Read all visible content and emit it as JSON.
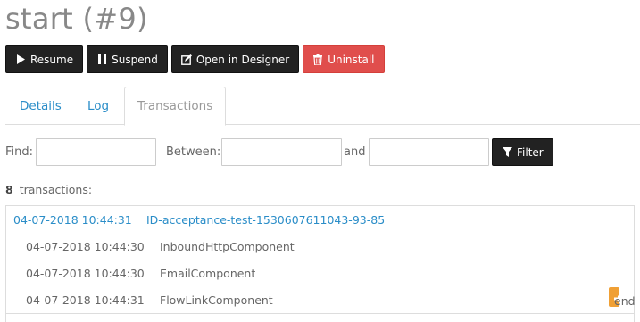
{
  "page": {
    "title": "start (#9)"
  },
  "toolbar": {
    "resume_label": "Resume",
    "suspend_label": "Suspend",
    "designer_label": "Open in Designer",
    "uninstall_label": "Uninstall",
    "colors": {
      "dark": "#222222",
      "danger": "#e04e4c"
    }
  },
  "tabs": [
    {
      "label": "Details",
      "active": false
    },
    {
      "label": "Log",
      "active": false
    },
    {
      "label": "Transactions",
      "active": true
    }
  ],
  "filter": {
    "find_label": "Find:",
    "find_value": "",
    "between_label": "Between:",
    "between_value": "",
    "and_label": "and",
    "and_value": "",
    "button_label": "Filter"
  },
  "transactions": {
    "count": "8",
    "count_label": "transactions:",
    "header": {
      "timestamp": "04-07-2018 10:44:31",
      "id": "ID-acceptance-test-1530607611043-93-85"
    },
    "rows": [
      {
        "timestamp": "04-07-2018 10:44:30",
        "component": "InboundHttpComponent"
      },
      {
        "timestamp": "04-07-2018 10:44:30",
        "component": "EmailComponent"
      },
      {
        "timestamp": "04-07-2018 10:44:31",
        "component": "FlowLinkComponent",
        "badge": "end"
      }
    ],
    "badge_color": "#f0a035",
    "link_color": "#2a8dc8"
  }
}
